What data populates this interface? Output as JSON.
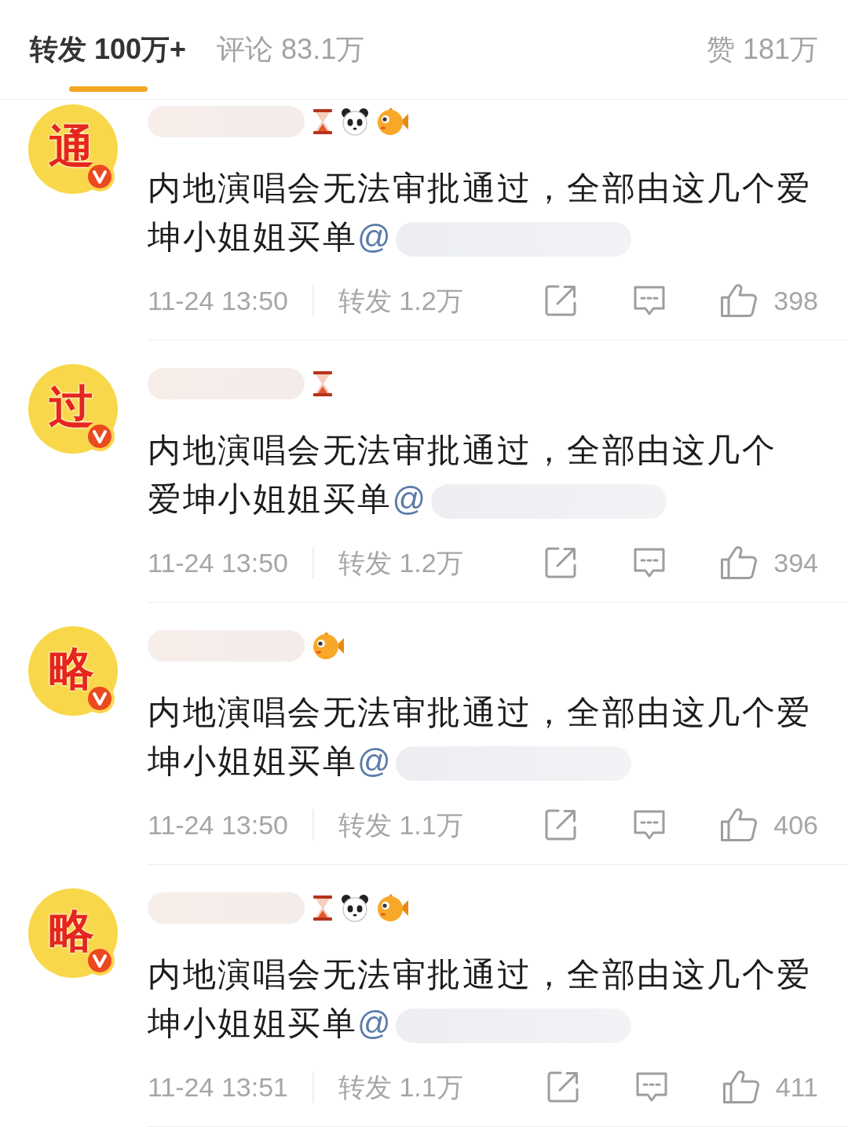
{
  "tabs": [
    {
      "label": "转发 100万+",
      "selected": true
    },
    {
      "label": "评论 83.1万",
      "selected": false
    }
  ],
  "likes_tab": {
    "label": "赞 181万"
  },
  "reposts": [
    {
      "avatar_text": "通",
      "verified": true,
      "name_hidden": true,
      "badges": [
        {
          "kind": "hourglass"
        },
        {
          "kind": "panda"
        },
        {
          "kind": "fish"
        }
      ],
      "text_lines": [
        "内地演唱会无法审批通过，全部由这几个爱",
        "坤小姐姐买单"
      ],
      "mention": "@",
      "mention_hidden": true,
      "time": "11-24 13:50",
      "repost_count": "转发 1.2万",
      "like_count": "398"
    },
    {
      "avatar_text": "过",
      "verified": true,
      "name_hidden": true,
      "badges": [
        {
          "kind": "hourglass"
        }
      ],
      "text_lines": [
        "内地演唱会无法审批通过，全部由这几个",
        "爱坤小姐姐买单"
      ],
      "mention": "@",
      "mention_hidden": true,
      "time": "11-24 13:50",
      "repost_count": "转发 1.2万",
      "like_count": "394"
    },
    {
      "avatar_text": "略",
      "verified": true,
      "name_hidden": true,
      "badges": [
        {
          "kind": "fish"
        }
      ],
      "text_lines": [
        "内地演唱会无法审批通过，全部由这几个爱",
        "坤小姐姐买单"
      ],
      "mention": "@",
      "mention_hidden": true,
      "time": "11-24 13:50",
      "repost_count": "转发 1.1万",
      "like_count": "406"
    },
    {
      "avatar_text": "略",
      "verified": true,
      "name_hidden": true,
      "badges": [
        {
          "kind": "hourglass"
        },
        {
          "kind": "panda"
        },
        {
          "kind": "fish"
        }
      ],
      "text_lines": [
        "内地演唱会无法审批通过，全部由这几个爱",
        "坤小姐姐买单"
      ],
      "mention": "@",
      "mention_hidden": true,
      "time": "11-24 13:51",
      "repost_count": "转发 1.1万",
      "like_count": "411"
    }
  ]
}
